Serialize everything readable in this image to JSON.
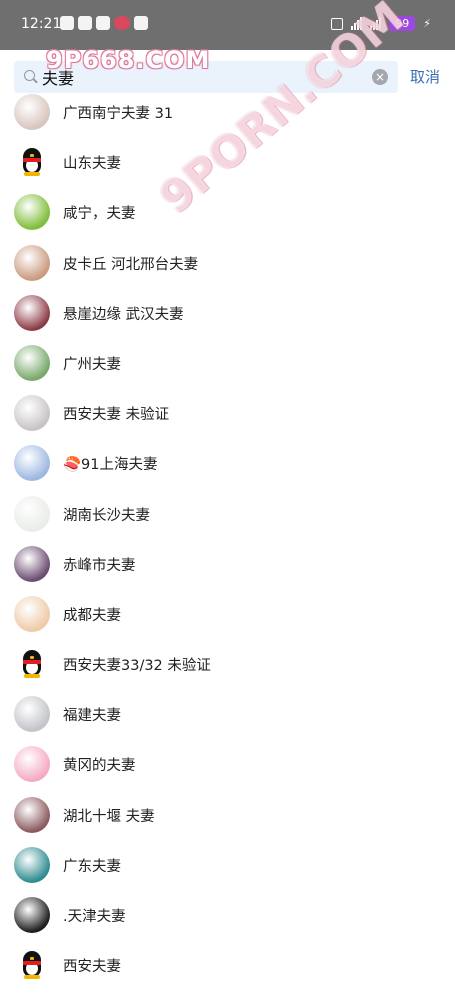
{
  "status_bar": {
    "time": "12:21",
    "battery": "99"
  },
  "watermark": "9P668.COM",
  "watermark_diag": "9PORN.COM",
  "search": {
    "query": "夫妻",
    "placeholder": "",
    "cancel_label": "取消"
  },
  "results": [
    {
      "name": "广西南宁夫妻 31",
      "avatar": "#d8c5bd"
    },
    {
      "name": "山东夫妻",
      "avatar": "penguin"
    },
    {
      "name": "咸宁，夫妻",
      "avatar": "#7fbd3a"
    },
    {
      "name": "皮卡丘  河北邢台夫妻",
      "avatar": "#c99a7d"
    },
    {
      "name": "悬崖边缘 武汉夫妻",
      "avatar": "#8c3b46"
    },
    {
      "name": "广州夫妻",
      "avatar": "#78a86a"
    },
    {
      "name": "西安夫妻 未验证",
      "avatar": "#c8c4c6"
    },
    {
      "name": "🍣91上海夫妻",
      "avatar": "#9db7e1"
    },
    {
      "name": "湖南长沙夫妻",
      "avatar": "#e9ece7"
    },
    {
      "name": "赤峰市夫妻",
      "avatar": "#6b4c72"
    },
    {
      "name": "成都夫妻",
      "avatar": "#efcaa7"
    },
    {
      "name": "西安夫妻33/32 未验证",
      "avatar": "penguin"
    },
    {
      "name": "福建夫妻",
      "avatar": "#c2c4c9"
    },
    {
      "name": "黄冈的夫妻",
      "avatar": "#f4a9c3"
    },
    {
      "name": "湖北十堰 夫妻",
      "avatar": "#8a5a5e"
    },
    {
      "name": "广东夫妻",
      "avatar": "#2f8b8f"
    },
    {
      "name": ".天津夫妻",
      "avatar": "#1e1e1e"
    },
    {
      "name": "西安夫妻",
      "avatar": "penguin"
    }
  ]
}
